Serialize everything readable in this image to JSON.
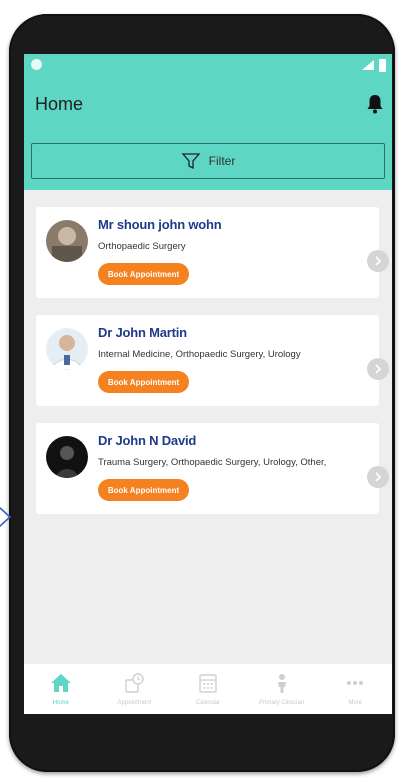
{
  "app": {
    "title": "Home"
  },
  "filter": {
    "label": "Filter"
  },
  "doctors": [
    {
      "name": "Mr shoun john wohn",
      "specialty": "Orthopaedic Surgery",
      "book_label": "Book Appointment"
    },
    {
      "name": "Dr John  Martin",
      "specialty": "Internal Medicine, Orthopaedic Surgery, Urology",
      "book_label": "Book Appointment"
    },
    {
      "name": "Dr John N David",
      "specialty": "Trauma Surgery, Orthopaedic Surgery, Urology, Other,",
      "book_label": "Book Appointment"
    }
  ],
  "tabs": [
    {
      "label": "Home",
      "icon": "home-icon",
      "active": true
    },
    {
      "label": "Appointment",
      "icon": "appointment-icon",
      "active": false
    },
    {
      "label": "Calendar",
      "icon": "calendar-icon",
      "active": false
    },
    {
      "label": "Primary Clinician",
      "icon": "clinician-icon",
      "active": false
    },
    {
      "label": "More",
      "icon": "more-icon",
      "active": false
    }
  ],
  "colors": {
    "accent": "#5dd6c3",
    "button": "#f58220",
    "name": "#1f3a8a"
  }
}
